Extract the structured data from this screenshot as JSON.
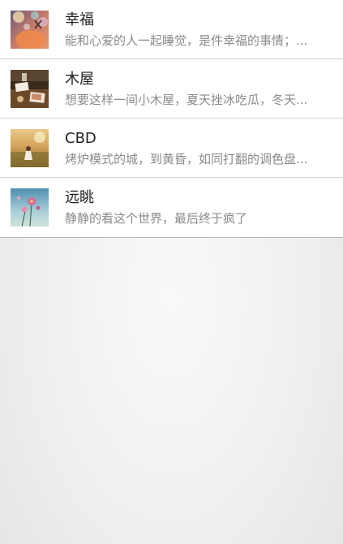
{
  "list": {
    "items": [
      {
        "title": "幸福",
        "desc": "能和心爱的人一起睡觉，是件幸福的事情；...",
        "thumb": "bokeh-photo"
      },
      {
        "title": "木屋",
        "desc": "想要这样一间小木屋，夏天挫冰吃瓜，冬天...",
        "thumb": "wooden-table-photo"
      },
      {
        "title": "CBD",
        "desc": "烤炉模式的城，到黄昏，如同打翻的调色盘...",
        "thumb": "field-sunset-photo"
      },
      {
        "title": "远眺",
        "desc": "静静的看这个世界，最后终于疯了",
        "thumb": "flower-sky-photo"
      }
    ]
  }
}
